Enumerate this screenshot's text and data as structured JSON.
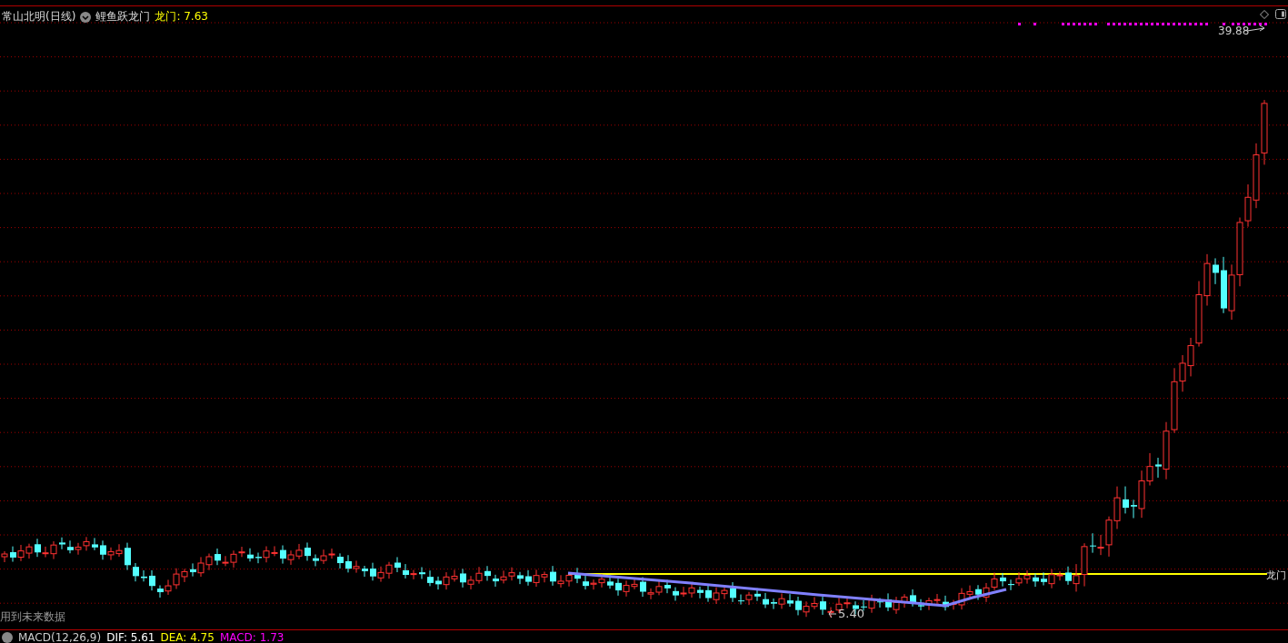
{
  "header": {
    "title": "常山北明(日线)",
    "indicator": "鲤鱼跃龙门",
    "line_label": "龙门",
    "line_value": ": 7.63"
  },
  "chart": {
    "high_label": "39.88",
    "low_label": "5.40",
    "right_label": "龙门",
    "note": "用到未来数据"
  },
  "macd_bar": {
    "title": "MACD(12,26,9)",
    "dif": "DIF: 5.61",
    "dea": "DEA: 4.75",
    "macd": "MACD: 1.73"
  }
}
